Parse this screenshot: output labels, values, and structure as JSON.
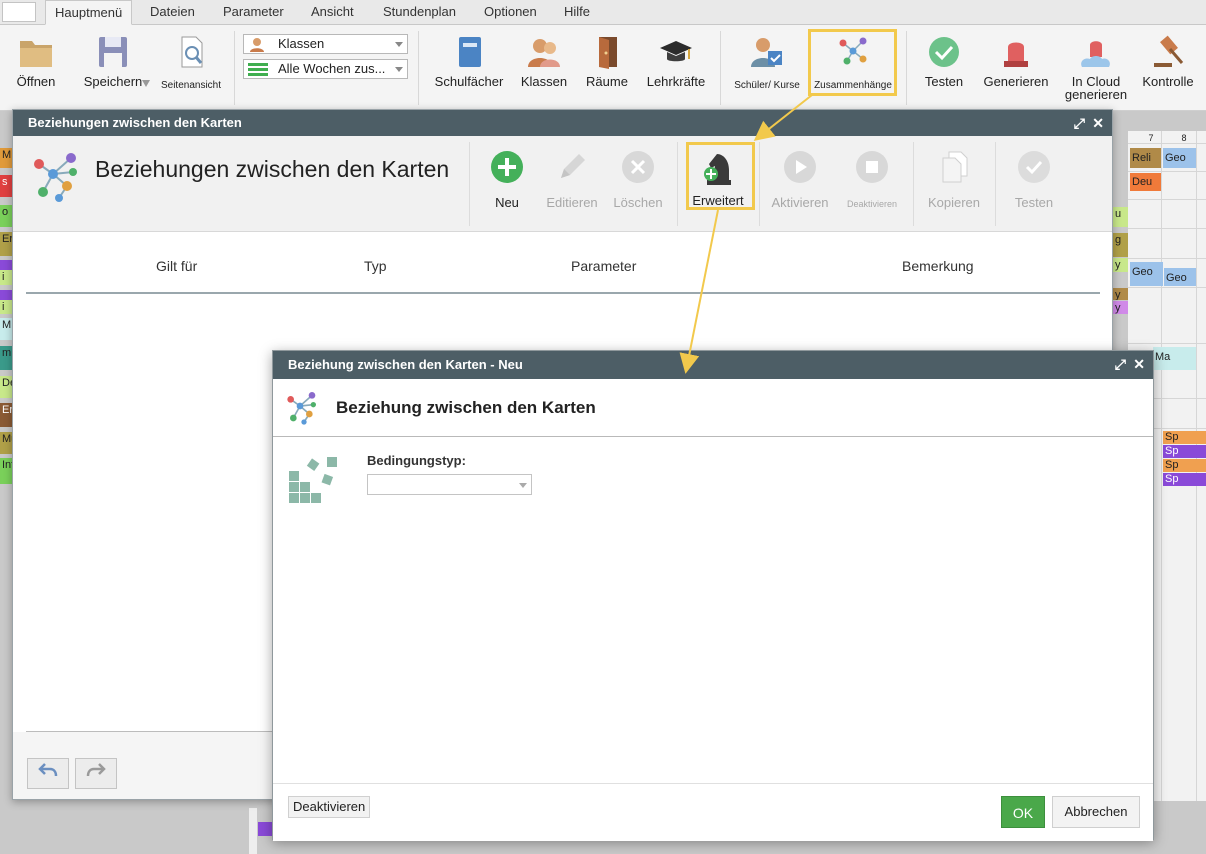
{
  "menu": {
    "tabs": [
      "Hauptmenü",
      "Dateien",
      "Parameter",
      "Ansicht",
      "Stundenplan",
      "Optionen",
      "Hilfe"
    ]
  },
  "ribbon": {
    "open": "Öffnen",
    "save": "Speichern",
    "print_preview": "Seitenansicht",
    "class_select": "Klassen",
    "weeks_select": "Alle Wochen zus...",
    "subjects": "Schulfächer",
    "classes": "Klassen",
    "rooms": "Räume",
    "teachers": "Lehrkräfte",
    "students": "Schüler/ Kurse",
    "relations": "Zusammenhänge",
    "test": "Testen",
    "generate": "Generieren",
    "cloud_line1": "In Cloud",
    "cloud_line2": "generieren",
    "check": "Kontrolle"
  },
  "background": {
    "col_headers": [
      "7",
      "8"
    ],
    "cells": [
      "Reli",
      "Geo",
      "Deu",
      "Geo",
      "Geo",
      "Ma",
      "Sp",
      "Sp",
      "Sp",
      "Sp"
    ],
    "left_labels": [
      "M",
      "s",
      "o",
      "Er",
      "i",
      "i",
      "M",
      "m",
      "De",
      "Er",
      "Mu",
      "Inf"
    ],
    "mid_labels": [
      "u",
      "g",
      "y",
      "y",
      "y"
    ]
  },
  "dialog_main": {
    "window_title": "Beziehungen zwischen den Karten",
    "heading": "Beziehungen zwischen den Karten",
    "toolbar": {
      "new": "Neu",
      "edit": "Editieren",
      "delete": "Löschen",
      "advanced": "Erweitert",
      "activate": "Aktivieren",
      "deactivate": "Deaktivieren",
      "copy": "Kopieren",
      "test": "Testen"
    },
    "columns": [
      "Gilt für",
      "Typ",
      "Parameter",
      "Bemerkung"
    ]
  },
  "dialog_new": {
    "window_title": "Beziehung zwischen den Karten - Neu",
    "heading": "Beziehung zwischen den Karten",
    "condition_label": "Bedingungstyp:",
    "condition_value": "",
    "deactivate": "Deaktivieren",
    "ok": "OK",
    "cancel": "Abbrechen"
  },
  "colors": {
    "titlebar": "#4d5e66",
    "highlight": "#f2c94c",
    "ok_green": "#4aa84a"
  }
}
